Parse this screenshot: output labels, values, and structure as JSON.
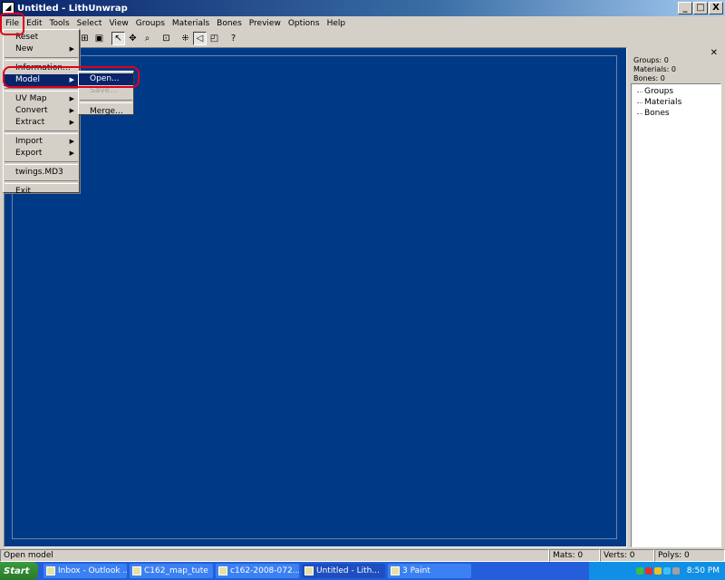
{
  "window": {
    "title": "Untitled - LithUnwrap",
    "buttons": [
      "_",
      "□",
      "X"
    ]
  },
  "menubar": {
    "items": [
      "File",
      "Edit",
      "Tools",
      "Select",
      "View",
      "Groups",
      "Materials",
      "Bones",
      "Preview",
      "Options",
      "Help"
    ]
  },
  "toolbar": {
    "icons": [
      "unwrap-icon",
      "region-icon",
      "pointer-icon",
      "move-icon",
      "zoom-icon",
      "fit-icon",
      "vertex-icon",
      "edge-icon",
      "face-icon",
      "help-pointer-icon"
    ]
  },
  "file_menu": {
    "items": [
      {
        "label": "Reset"
      },
      {
        "label": "New"
      },
      {
        "label": "Information..."
      },
      {
        "label": "Model"
      },
      {
        "label": "UV Map"
      },
      {
        "label": "Convert"
      },
      {
        "label": "Extract"
      },
      {
        "label": "Import"
      },
      {
        "label": "Export"
      },
      {
        "label": "twings.MD3"
      },
      {
        "label": "Exit"
      }
    ]
  },
  "model_submenu": {
    "open": "Open...",
    "save": "Save...",
    "merge": "Merge..."
  },
  "right_panel": {
    "close": "✕",
    "stats": [
      "Groups: 0",
      "Materials: 0",
      "Bones: 0"
    ],
    "tree": [
      "Groups",
      "Materials",
      "Bones"
    ]
  },
  "statusbar": {
    "message": "Open model",
    "mats": "Mats: 0",
    "verts": "Verts: 0",
    "polys": "Polys: 0"
  },
  "taskbar": {
    "start": "Start",
    "tasks": [
      {
        "label": "Inbox - Outlook ..."
      },
      {
        "label": "C162_map_tute"
      },
      {
        "label": "c162-2008-072..."
      },
      {
        "label": "Untitled - Lith..."
      },
      {
        "label": "3 Paint"
      }
    ],
    "clock": "8:50 PM"
  },
  "colors": {
    "viewport": "#003a86",
    "highlight": "#0a246a",
    "annotation": "#e0001a"
  }
}
